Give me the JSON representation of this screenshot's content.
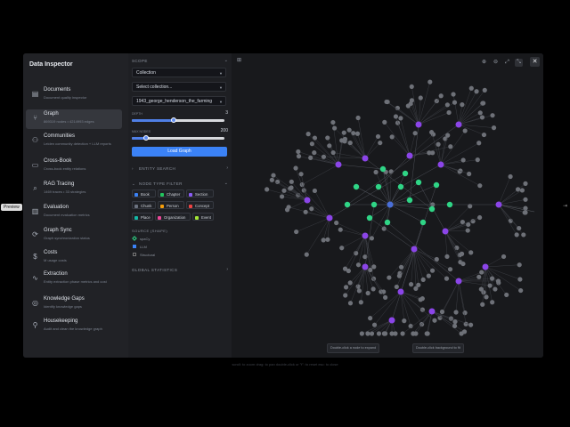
{
  "sidebar": {
    "title": "Data Inspector",
    "items": [
      {
        "label": "Documents",
        "sub": "Document quality inspector",
        "icon": "document-icon",
        "glyph": "▤"
      },
      {
        "label": "Graph",
        "sub": "869319 nodes • 4214993 edges",
        "icon": "graph-icon",
        "glyph": "⑂"
      },
      {
        "label": "Communities",
        "sub": "Leiden community detection + LLM reports",
        "icon": "people-icon",
        "glyph": "⚇"
      },
      {
        "label": "Cross-Book",
        "sub": "Cross-book entity relations",
        "icon": "book-icon",
        "glyph": "▭"
      },
      {
        "label": "RAG Tracing",
        "sub": "1469 traces • 33 strategies",
        "icon": "trace-icon",
        "glyph": "⌕"
      },
      {
        "label": "Evaluation",
        "sub": "Document evaluation metrics",
        "icon": "chart-icon",
        "glyph": "▥"
      },
      {
        "label": "Graph Sync",
        "sub": "Graph synchronization status",
        "icon": "sync-icon",
        "glyph": "⟳"
      },
      {
        "label": "Costs",
        "sub": "M usage costs",
        "icon": "dollar-icon",
        "glyph": "$"
      },
      {
        "label": "Extraction",
        "sub": "Entity extraction phase metrics and cost",
        "icon": "pulse-icon",
        "glyph": "∿"
      },
      {
        "label": "Knowledge Gaps",
        "sub": "Identify knowledge gaps",
        "icon": "target-icon",
        "glyph": "◎"
      },
      {
        "label": "Housekeeping",
        "sub": "Audit and clean the knowledge graph",
        "icon": "broom-icon",
        "glyph": "⚲"
      }
    ],
    "tooltip": "Preview"
  },
  "panel": {
    "scope_heading": "SCOPE",
    "scope_select": "Collection",
    "collection_select": "Select collection...",
    "book_select": "1943_george_henderson_the_farming",
    "depth_label": "DEPTH",
    "depth_value": "3",
    "depth_fraction": 0.45,
    "max_nodes_label": "MAX NODES",
    "max_nodes_value": "200",
    "max_nodes_fraction": 0.15,
    "load_button": "Load Graph",
    "entity_search": "ENTITY SEARCH",
    "node_type_filter": "NODE TYPE FILTER",
    "chips": [
      {
        "label": "Book",
        "color": "#3b82f6"
      },
      {
        "label": "Chapter",
        "color": "#22c55e"
      },
      {
        "label": "Section",
        "color": "#8b5cf6"
      },
      {
        "label": "Chunk",
        "color": "#6b7280"
      },
      {
        "label": "Person",
        "color": "#f59e0b"
      },
      {
        "label": "Concept",
        "color": "#ef4444"
      },
      {
        "label": "Place",
        "color": "#14b8a6"
      },
      {
        "label": "Organization",
        "color": "#ec4899"
      },
      {
        "label": "Event",
        "color": "#a3e635"
      }
    ],
    "source_heading": "SOURCE (SHAPE)",
    "sources": [
      "spaCy",
      "LLM",
      "Structural"
    ],
    "global_statistics": "GLOBAL STATISTICS"
  },
  "canvas": {
    "hint_left": "Double-click a node to expand",
    "hint_right": "Double-click background to fit",
    "colors": {
      "chunk": "#6e7178",
      "section": "#8b45e8",
      "chapter": "#2fd586",
      "book": "#4a6fd8",
      "edge": "#3a3c42"
    }
  },
  "footer": "scroll: to zoom   drag: to pan   double-click or \"f\": to reset   esc: to close"
}
